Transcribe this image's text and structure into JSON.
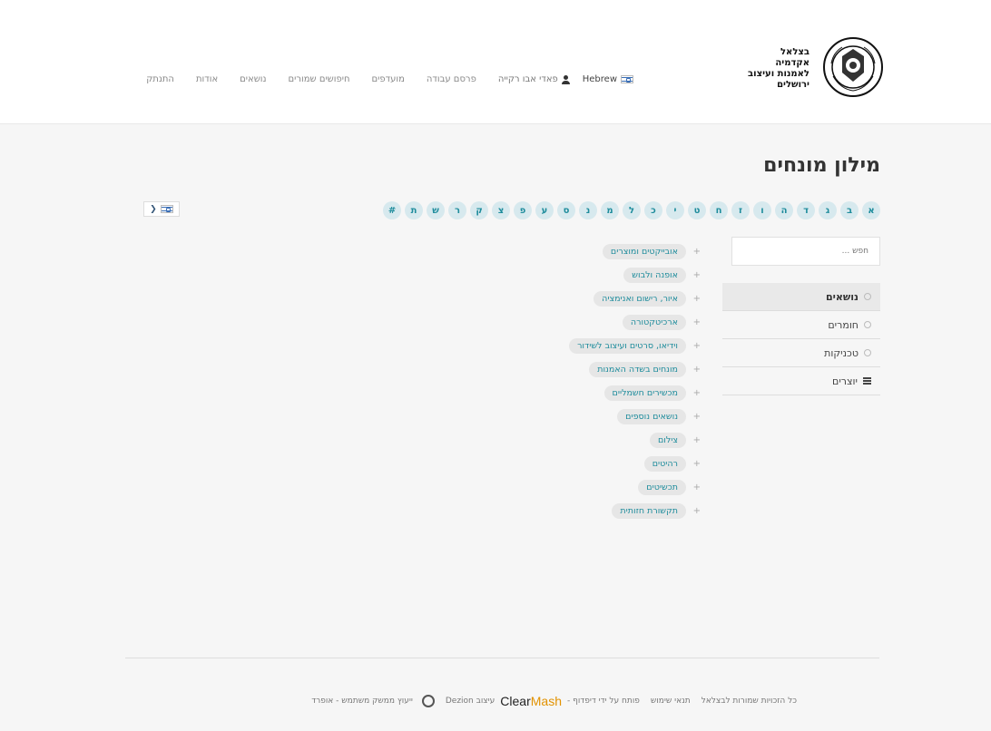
{
  "header": {
    "logo_lines": [
      "בצלאל",
      "אקדמיה",
      "לאמנות ועיצוב",
      "ירושלים"
    ],
    "language": "Hebrew",
    "user_name": "פאדי אבו רקייה",
    "nav": [
      "פרסם עבודה",
      "מועדפים",
      "חיפושים שמורים",
      "נושאים",
      "אודות",
      "התנתק"
    ]
  },
  "page": {
    "title": "מילון מונחים",
    "alphabet": [
      "א",
      "ב",
      "ג",
      "ד",
      "ה",
      "ו",
      "ז",
      "ח",
      "ט",
      "י",
      "כ",
      "ל",
      "מ",
      "נ",
      "ס",
      "ע",
      "פ",
      "צ",
      "ק",
      "ר",
      "ש",
      "ת",
      "#"
    ]
  },
  "sidebar": {
    "search_placeholder": "חפש ...",
    "filters": [
      {
        "label": "נושאים",
        "active": true,
        "icon": "radio-icon"
      },
      {
        "label": "חומרים",
        "active": false,
        "icon": "radio-icon"
      },
      {
        "label": "טכניקות",
        "active": false,
        "icon": "radio-icon"
      },
      {
        "label": "יוצרים",
        "active": false,
        "icon": "list-icon"
      }
    ]
  },
  "topics": [
    "אובייקטים ומוצרים",
    "אופנה ולבוש",
    "איור, רישום ואנימציה",
    "ארכיטקטורה",
    "וידיאו, סרטים ועיצוב לשידור",
    "מונחים בשדה האמנות",
    "מכשירים חשמליים",
    "נושאים נוספים",
    "צילום",
    "רהיטים",
    "תכשיטים",
    "תקשורת חזותית"
  ],
  "footer": {
    "copyright": "כל הזכויות שמורות לבצלאל",
    "terms": "תנאי שימוש",
    "dev": "פותח על ידי דיפדוף -",
    "clearmash_a": "Clear",
    "clearmash_b": "Mash",
    "design": "עיצוב Dezion",
    "ux": "ייעוץ ממשק משתמש - אופרד"
  },
  "colors": {
    "accent": "#1e8c9c",
    "pill_bg": "#e6e6e6",
    "letter_bg": "#d7e9ee"
  }
}
